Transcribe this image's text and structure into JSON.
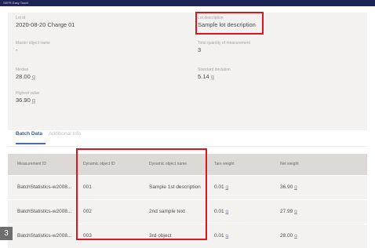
{
  "window": {
    "title": "SEFR Easy Touch"
  },
  "summary": {
    "lot_id": {
      "label": "Lot id",
      "value": "2020-08-20 Charge 01"
    },
    "lot_description": {
      "label": "Lot description",
      "value": "Sample lot description"
    },
    "master_object_name": {
      "label": "Master object name",
      "value": "-"
    },
    "total_quantity": {
      "label": "Total quantity of measurement",
      "value": "3"
    },
    "median": {
      "label": "Median",
      "value": "28.00",
      "unit": "g"
    },
    "standard_deviation": {
      "label": "Standard deviation",
      "value": "5.14",
      "unit": "g"
    },
    "highest_value": {
      "label": "Highest value",
      "value": "36.90",
      "unit": "g"
    }
  },
  "tabs": {
    "batch_data": "Batch Data",
    "additional_info": "Additional Info"
  },
  "table": {
    "headers": [
      "Measurement ID",
      "Dynamic object ID",
      "Dynamic object name",
      "Tare weight",
      "Net weight"
    ],
    "rows": [
      {
        "measurement_id": "BatchStatistics-w2008...",
        "object_id": "001",
        "object_name": "Sample 1st description",
        "tare": "0.01",
        "tare_unit": "g",
        "net": "36.90",
        "net_unit": "g"
      },
      {
        "measurement_id": "BatchStatistics-w2008...",
        "object_id": "002",
        "object_name": "2nd sample text",
        "tare": "0.01",
        "tare_unit": "g",
        "net": "27.99",
        "net_unit": "g"
      },
      {
        "measurement_id": "BatchStatistics-w2008...",
        "object_id": "003",
        "object_name": "3rd object",
        "tare": "0.01",
        "tare_unit": "g",
        "net": "28.00",
        "net_unit": "g"
      }
    ]
  },
  "annotation": {
    "step_number": "3",
    "highlight_color": "#e0141f"
  }
}
